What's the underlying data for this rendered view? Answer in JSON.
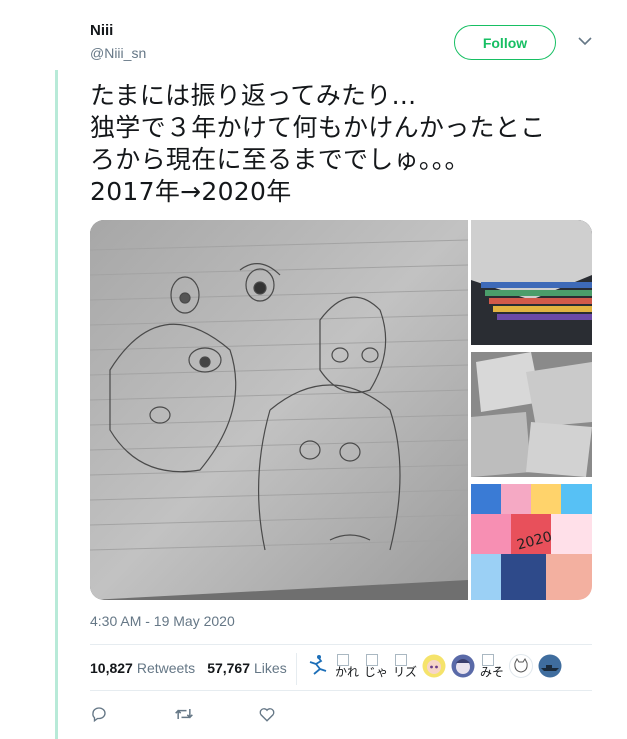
{
  "author": {
    "name": "Niii",
    "handle": "@Niii_sn"
  },
  "follow_label": "Follow",
  "tweet_lines": [
    "たまには振り返ってみたり...",
    "独学で３年かけて何もかけんかったとこ",
    "ろから現在に至るまででしゅ。。。",
    "2017年→2020年"
  ],
  "timestamp": "4:30 AM - 19 May 2020",
  "stats": {
    "retweets_count": "10,827",
    "retweets_label": "Retweets",
    "likes_count": "57,767",
    "likes_label": "Likes"
  },
  "likers": [
    {
      "type": "icon",
      "icon": "figure-skater-icon"
    },
    {
      "type": "broken",
      "alt": "かれ"
    },
    {
      "type": "broken",
      "alt": "じゃ"
    },
    {
      "type": "broken",
      "alt": "リズ"
    },
    {
      "type": "avatar",
      "icon": "anime-avatar-icon"
    },
    {
      "type": "avatar",
      "icon": "anime-avatar-icon"
    },
    {
      "type": "broken",
      "alt": "みそ"
    },
    {
      "type": "avatar",
      "icon": "cat-sketch-icon"
    },
    {
      "type": "avatar",
      "icon": "ship-silhouette-icon"
    }
  ],
  "actions": [
    "reply-icon",
    "retweet-icon",
    "like-icon"
  ],
  "colors": {
    "accent": "#17bf63",
    "muted": "#657786",
    "thread": "#b8ead8"
  }
}
